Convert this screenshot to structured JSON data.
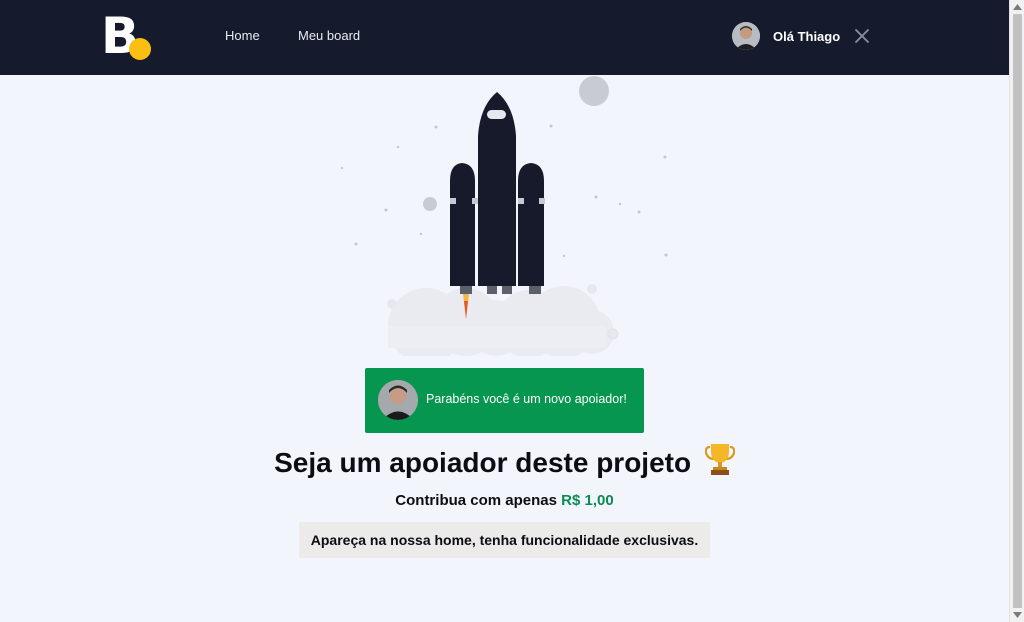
{
  "header": {
    "logo_letter": "B",
    "nav": [
      {
        "label": "Home"
      },
      {
        "label": "Meu board"
      }
    ],
    "user": {
      "greeting": "Olá Thiago"
    }
  },
  "toast": {
    "message": "Parabéns você é um novo apoiador!"
  },
  "main": {
    "headline": "Seja um apoiador deste projeto",
    "contribute_prefix": "Contribua com apenas",
    "price": "R$ 1,00",
    "benefit": "Apareça na nossa home, tenha funcionalidade exclusivas."
  },
  "colors": {
    "header_bg": "#151a2d",
    "page_bg": "#f3f5fc",
    "accent_yellow": "#fbbf12",
    "toast_green": "#07964f",
    "price_green": "#0b8a54"
  },
  "icons": [
    "close-icon",
    "trophy-icon",
    "rocket-illustration"
  ]
}
